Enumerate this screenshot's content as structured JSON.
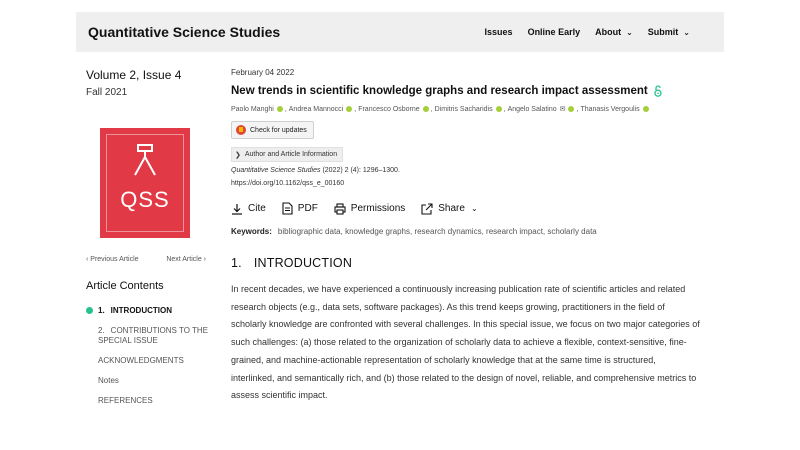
{
  "header": {
    "site_title": "Quantitative Science Studies",
    "nav": [
      {
        "label": "Issues",
        "dropdown": false
      },
      {
        "label": "Online Early",
        "dropdown": false
      },
      {
        "label": "About",
        "dropdown": true
      },
      {
        "label": "Submit",
        "dropdown": true
      }
    ]
  },
  "sidebar": {
    "issue": "Volume 2, Issue 4",
    "season": "Fall 2021",
    "cover_text": "QSS",
    "prev_article": "Previous Article",
    "next_article": "Next Article",
    "contents_title": "Article Contents",
    "toc": [
      {
        "num": "1.",
        "label": "INTRODUCTION",
        "active": true
      },
      {
        "num": "2.",
        "label": "CONTRIBUTIONS TO THE SPECIAL ISSUE",
        "active": false
      },
      {
        "num": "",
        "label": "ACKNOWLEDGMENTS",
        "active": false
      },
      {
        "num": "",
        "label": "Notes",
        "active": false
      },
      {
        "num": "",
        "label": "REFERENCES",
        "active": false
      }
    ]
  },
  "article": {
    "date": "February 04 2022",
    "title": "New trends in scientific knowledge graphs and research impact assessment",
    "authors": [
      "Paolo Manghi",
      "Andrea Mannocci",
      "Francesco Osborne",
      "Dimitris Sacharidis",
      "Angelo Salatino",
      "Thanasis Vergoulis"
    ],
    "check_updates": "Check for updates",
    "author_info": "Author and Article Information",
    "citation_journal": "Quantitative Science Studies",
    "citation_rest": " (2022) 2 (4): 1296–1300.",
    "doi": "https://doi.org/10.1162/qss_e_00160",
    "tools": {
      "cite": "Cite",
      "pdf": "PDF",
      "permissions": "Permissions",
      "share": "Share"
    },
    "keywords_label": "Keywords:",
    "keywords": "bibliographic data, knowledge graphs, research dynamics, research impact, scholarly data",
    "section_num": "1.",
    "section_title": "INTRODUCTION",
    "body": "In recent decades, we have experienced a continuously increasing publication rate of scientific articles and related research objects (e.g., data sets, software packages). As this trend keeps growing, practitioners in the field of scholarly knowledge are confronted with several challenges. In this special issue, we focus on two major categories of such challenges: (a) those related to the organization of scholarly data to achieve a flexible, context-sensitive, fine-grained, and machine-actionable representation of scholarly knowledge that at the same time is structured, interlinked, and semantically rich, and (b) those related to the design of novel, reliable, and comprehensive metrics to assess scientific impact."
  },
  "colors": {
    "accent_green": "#27c28b",
    "cover_red": "#e13a46",
    "orcid_green": "#a6ce39"
  }
}
